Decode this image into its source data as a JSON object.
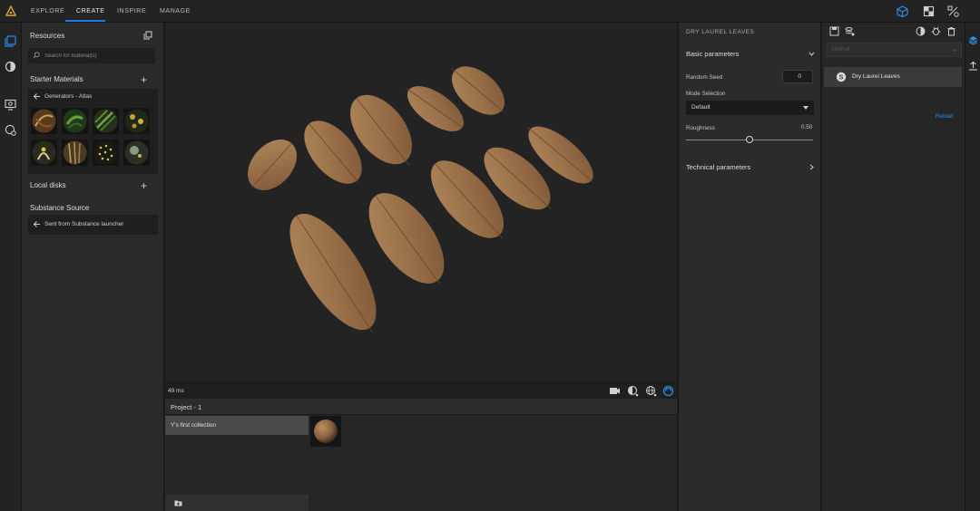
{
  "nav": {
    "tabs": [
      {
        "label": "EXPLORE"
      },
      {
        "label": "CREATE"
      },
      {
        "label": "INSPIRE"
      },
      {
        "label": "MANAGE"
      }
    ],
    "right_icons": [
      "3d-view-icon",
      "2d-view-icon",
      "share-icon"
    ],
    "accent_color": "#1f7ae0"
  },
  "left_rail": {
    "icons": [
      "library-icon",
      "material-icon",
      "display-settings-icon",
      "environment-settings-icon"
    ]
  },
  "resources": {
    "title": "Resources",
    "search_placeholder": "Search for material(s)",
    "starter_materials": {
      "title": "Starter Materials",
      "back_label": "Generators - Atlas",
      "thumbnails": [
        "atlas-1",
        "atlas-2",
        "atlas-3",
        "atlas-4",
        "atlas-5",
        "atlas-6",
        "atlas-7",
        "atlas-8"
      ]
    },
    "local_disks": {
      "title": "Local disks"
    },
    "substance_source": {
      "title": "Substance Source",
      "back_label": "Sent from Substance launcher"
    }
  },
  "viewport": {
    "timing": "49 ms",
    "tool_icons": [
      "camera-icon",
      "lighting-icon",
      "environment-icon",
      "render-icon"
    ]
  },
  "project": {
    "title": "Project - 1",
    "collection": "Y's first collection"
  },
  "parameters": {
    "header": "DRY LAUREL LEAVES",
    "basic": {
      "title": "Basic parameters",
      "random_seed_label": "Random Seed",
      "random_seed_value": "0",
      "mode_label": "Mode Selection",
      "mode_value": "Default",
      "roughness_label": "Roughness",
      "roughness_value": "0.50",
      "roughness_fraction": 0.5
    },
    "technical": {
      "title": "Technical parameters"
    }
  },
  "right_panel": {
    "select_placeholder": "Normal",
    "item_label": "Dry Laurel Leaves",
    "reload_label": "Reload"
  }
}
